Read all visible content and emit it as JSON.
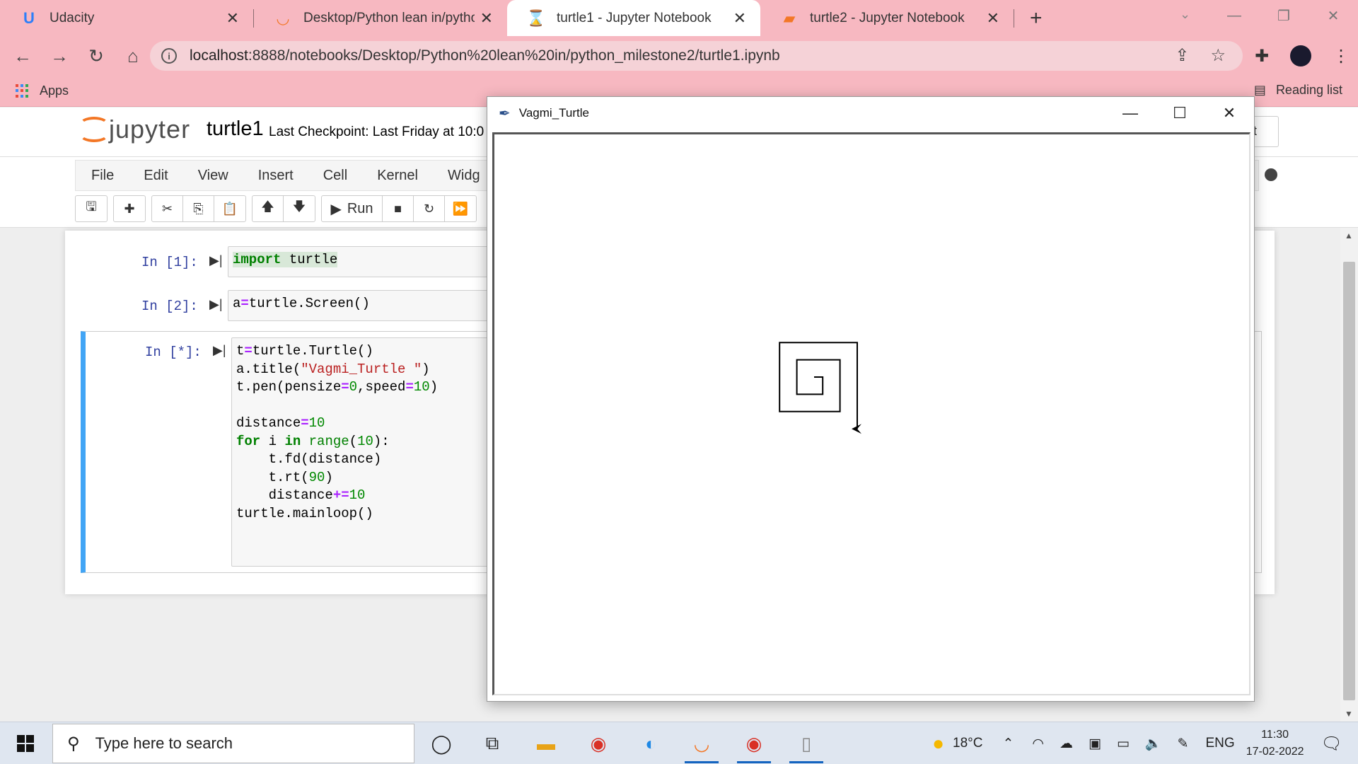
{
  "browser": {
    "tabs": [
      {
        "title": "Udacity",
        "icon": "udacity-icon",
        "active": false
      },
      {
        "title": "Desktop/Python lean in/python_",
        "icon": "jupyter-icon",
        "active": false
      },
      {
        "title": "turtle1 - Jupyter Notebook",
        "icon": "hourglass-icon",
        "active": true
      },
      {
        "title": "turtle2 - Jupyter Notebook",
        "icon": "notebook-icon",
        "active": false
      }
    ],
    "url_host": "localhost",
    "url_rest": ":8888/notebooks/Desktop/Python%20lean%20in/python_milestone2/turtle1.ipynb",
    "bookmarks_apps": "Apps",
    "reading_list": "Reading list"
  },
  "jupyter": {
    "logo_text": "jupyter",
    "notebook_name": "turtle1",
    "checkpoint": "Last Checkpoint: Last Friday at 10:0",
    "logout_partial": "ut",
    "menu": [
      "File",
      "Edit",
      "View",
      "Insert",
      "Cell",
      "Kernel",
      "Widg"
    ],
    "run_label": "Run",
    "cells": [
      {
        "prompt": "In [1]:"
      },
      {
        "prompt": "In [2]:"
      },
      {
        "prompt": "In [*]:"
      }
    ]
  },
  "turtle_window": {
    "title": "Vagmi_Turtle",
    "spiral_distance_start": 10,
    "spiral_steps": 10,
    "spiral_increment": 10
  },
  "taskbar": {
    "search_placeholder": "Type here to search",
    "weather": "18°C",
    "language": "ENG",
    "time": "11:30",
    "date": "17-02-2022"
  }
}
